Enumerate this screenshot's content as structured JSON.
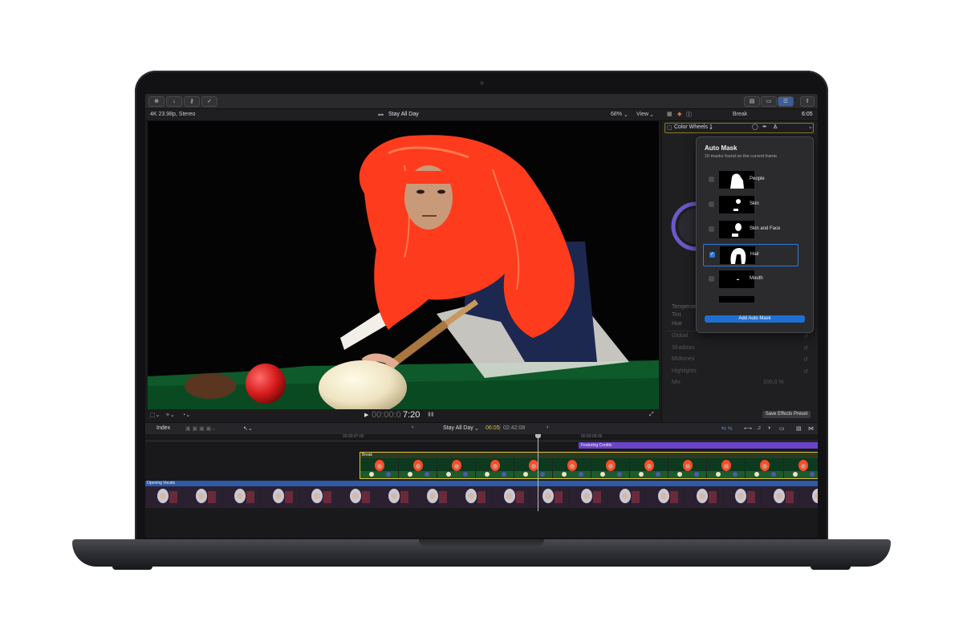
{
  "toolbar": {
    "icons": [
      "import-icon",
      "download-icon",
      "keys-icon",
      "check-icon"
    ],
    "right_icons": [
      "browser-layout-icon",
      "timeline-layout-icon",
      "inspector-layout-icon",
      "share-icon"
    ]
  },
  "infobar": {
    "format": "4K 23.98p, Stereo",
    "project": "Stay All Day",
    "zoom": "68%",
    "view": "View",
    "clip": "Break",
    "duration": "6:05"
  },
  "viewer": {
    "timecode_dim": "00:00:0",
    "timecode": "7:20"
  },
  "inspector": {
    "effect": "Color Wheels 1",
    "rows": [
      {
        "label": "Temperature",
        "value": ""
      },
      {
        "label": "Tint",
        "value": ""
      },
      {
        "label": "Hue",
        "value": "0 °"
      },
      {
        "label": "Global",
        "value": ""
      },
      {
        "label": "Shadows",
        "value": ""
      },
      {
        "label": "Midtones",
        "value": ""
      },
      {
        "label": "Highlights",
        "value": ""
      },
      {
        "label": "Mix",
        "value": "100.0 %"
      }
    ],
    "save_preset": "Save Effects Preset"
  },
  "auto_mask": {
    "title": "Auto Mask",
    "subtitle": "10 masks found on the current frame.",
    "items": [
      {
        "label": "People",
        "checked": false
      },
      {
        "label": "Skin",
        "checked": false
      },
      {
        "label": "Skin and Face",
        "checked": false
      },
      {
        "label": "Hair",
        "checked": true
      },
      {
        "label": "Mouth",
        "checked": false
      }
    ],
    "add_button": "Add Auto Mask"
  },
  "timeline": {
    "index": "Index",
    "project": "Stay All Day",
    "position": "06:05",
    "length": "02:42:08",
    "ruler": [
      "00:00:07:00",
      "00:00:08:00"
    ],
    "clips": {
      "featuring": "Featuring Credits",
      "break": "Break",
      "opening": "Opening Vocals"
    }
  },
  "colors": {
    "selection_blue": "#2d7ad6",
    "clip_yellow": "#e2c43a",
    "featuring_purple": "#6b45c9",
    "timecode_yellow": "#d6b84a"
  }
}
